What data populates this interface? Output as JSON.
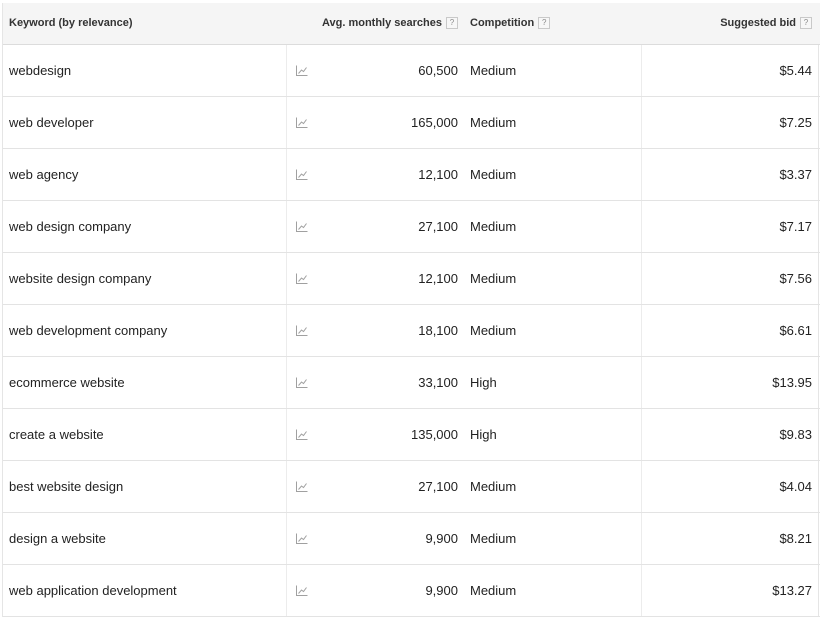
{
  "header": {
    "keyword": "Keyword (by relevance)",
    "searches": "Avg. monthly searches",
    "competition": "Competition",
    "bid": "Suggested bid",
    "help_glyph": "?"
  },
  "rows": [
    {
      "keyword": "webdesign",
      "searches": "60,500",
      "competition": "Medium",
      "bid": "$5.44"
    },
    {
      "keyword": "web developer",
      "searches": "165,000",
      "competition": "Medium",
      "bid": "$7.25"
    },
    {
      "keyword": "web agency",
      "searches": "12,100",
      "competition": "Medium",
      "bid": "$3.37"
    },
    {
      "keyword": "web design company",
      "searches": "27,100",
      "competition": "Medium",
      "bid": "$7.17"
    },
    {
      "keyword": "website design company",
      "searches": "12,100",
      "competition": "Medium",
      "bid": "$7.56"
    },
    {
      "keyword": "web development company",
      "searches": "18,100",
      "competition": "Medium",
      "bid": "$6.61"
    },
    {
      "keyword": "ecommerce website",
      "searches": "33,100",
      "competition": "High",
      "bid": "$13.95"
    },
    {
      "keyword": "create a website",
      "searches": "135,000",
      "competition": "High",
      "bid": "$9.83"
    },
    {
      "keyword": "best website design",
      "searches": "27,100",
      "competition": "Medium",
      "bid": "$4.04"
    },
    {
      "keyword": "design a website",
      "searches": "9,900",
      "competition": "Medium",
      "bid": "$8.21"
    },
    {
      "keyword": "web application development",
      "searches": "9,900",
      "competition": "Medium",
      "bid": "$13.27"
    }
  ],
  "icons": {
    "trend": "trend-chart-icon",
    "help": "help-icon"
  },
  "colors": {
    "header_bg": "#f5f5f5",
    "border": "#e3e3e3",
    "icon": "#9a9a9a"
  }
}
